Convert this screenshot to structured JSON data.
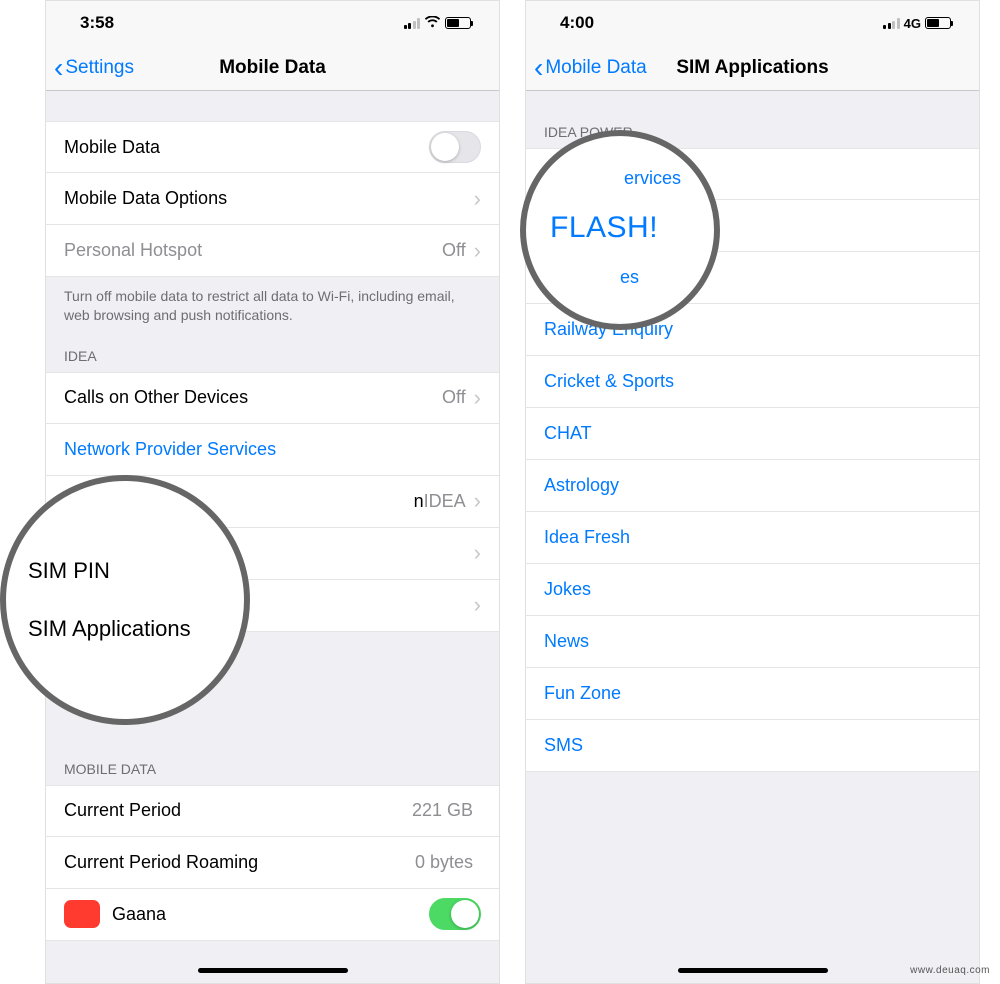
{
  "left": {
    "status": {
      "time": "3:58"
    },
    "nav": {
      "back": "Settings",
      "title": "Mobile Data"
    },
    "rows": {
      "mobile_data": "Mobile Data",
      "mobile_data_options": "Mobile Data Options",
      "personal_hotspot": "Personal Hotspot",
      "personal_hotspot_value": "Off",
      "footnote": "Turn off mobile data to restrict all data to Wi-Fi, including email, web browsing and push notifications.",
      "idea_header": "IDEA",
      "calls_other": "Calls on Other Devices",
      "calls_other_value": "Off",
      "network_provider": "Network Provider Services",
      "network_selection_partial": "n",
      "network_selection_value": "IDEA",
      "sim_pin": "SIM PIN",
      "sim_apps": "SIM Applications",
      "mobile_data_header": "MOBILE DATA",
      "current_period": "Current Period",
      "current_period_value": "221 GB",
      "current_period_roaming": "Current Period Roaming",
      "current_period_roaming_value": "0 bytes",
      "app_gaana": "Gaana"
    },
    "circle": {
      "l1": "SIM PIN",
      "l2": "SIM Applications"
    }
  },
  "right": {
    "status": {
      "time": "4:00",
      "net": "4G"
    },
    "nav": {
      "back": "Mobile Data",
      "title": "SIM Applications"
    },
    "header": "IDEA POWER",
    "items": {
      "my_services_partial": "ervices",
      "flash": "FLASH!",
      "partial_es": "es",
      "railway": "Railway Enquiry",
      "cricket": "Cricket & Sports",
      "chat": "CHAT",
      "astrology": "Astrology",
      "idea_fresh": "Idea Fresh",
      "jokes": "Jokes",
      "news": "News",
      "fun_zone": "Fun Zone",
      "sms": "SMS"
    },
    "circle": {
      "l1": "ervices",
      "l2": "FLASH!",
      "l3": "es"
    }
  },
  "watermark": "www.deuaq.com"
}
